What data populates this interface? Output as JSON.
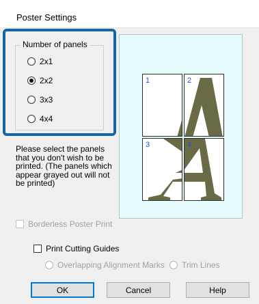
{
  "dialog": {
    "title": "Poster Settings"
  },
  "panels_group": {
    "legend": "Number of panels",
    "options": [
      {
        "label": "2x1",
        "selected": false
      },
      {
        "label": "2x2",
        "selected": true
      },
      {
        "label": "3x3",
        "selected": false
      },
      {
        "label": "4x4",
        "selected": false
      }
    ]
  },
  "help_text": "Please select the panels that you don't wish to be printed. (The panels which appear grayed out will not be printed)",
  "preview": {
    "panels": [
      {
        "number": "1"
      },
      {
        "number": "2"
      },
      {
        "number": "3"
      },
      {
        "number": "4"
      }
    ],
    "glyph_color": "#6a6a46"
  },
  "borderless": {
    "label": "Borderless Poster Print",
    "checked": false,
    "enabled": false
  },
  "cutting_guides": {
    "label": "Print Cutting Guides",
    "checked": false,
    "enabled": true
  },
  "guide_options": {
    "overlapping": {
      "label": "Overlapping Alignment Marks",
      "enabled": false
    },
    "trim": {
      "label": "Trim Lines",
      "enabled": false
    }
  },
  "buttons": {
    "ok": "OK",
    "cancel": "Cancel",
    "help": "Help"
  },
  "colors": {
    "highlight": "#1565a8",
    "preview_bg": "#e6fbfc",
    "panel_number": "#2050d8"
  }
}
